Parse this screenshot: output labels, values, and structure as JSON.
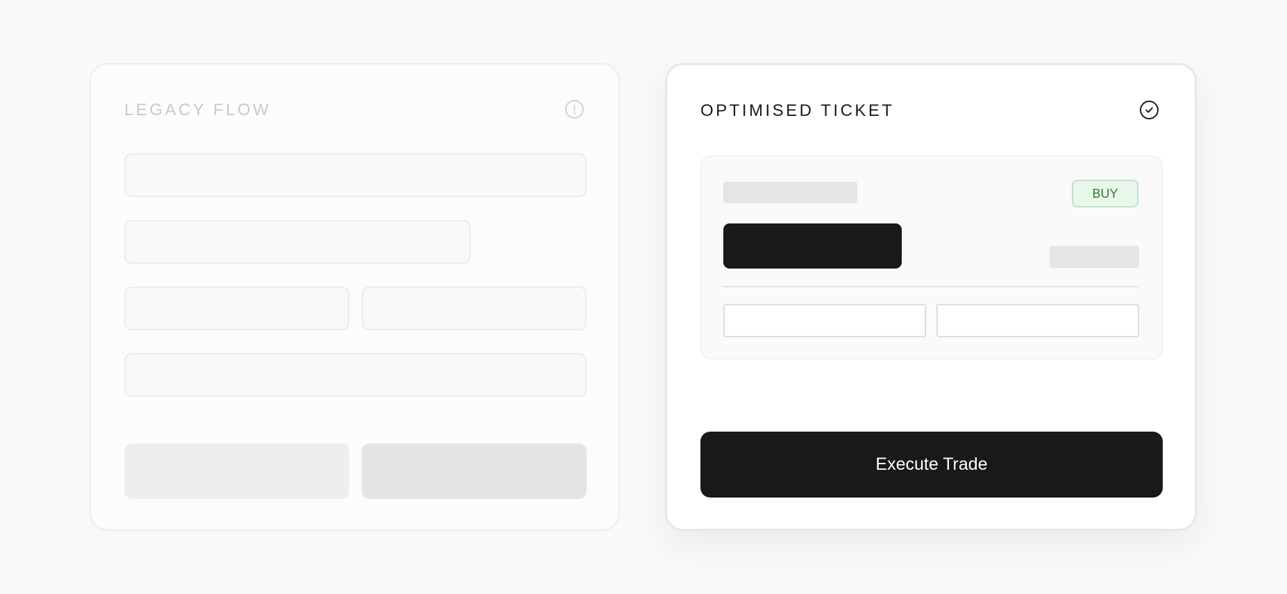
{
  "legacy_card": {
    "title": "LEGACY FLOW",
    "status_icon": "alert-circle-icon"
  },
  "optimised_card": {
    "title": "OPTIMISED TICKET",
    "status_icon": "check-circle-icon",
    "ticket": {
      "side_badge": "BUY"
    },
    "execute_label": "Execute Trade"
  },
  "colors": {
    "page_background": "#f9f9f9",
    "primary_dark": "#191919",
    "buy_text": "#2e7d32",
    "buy_background": "#e9f6ea",
    "buy_border": "#bfe3c5"
  }
}
